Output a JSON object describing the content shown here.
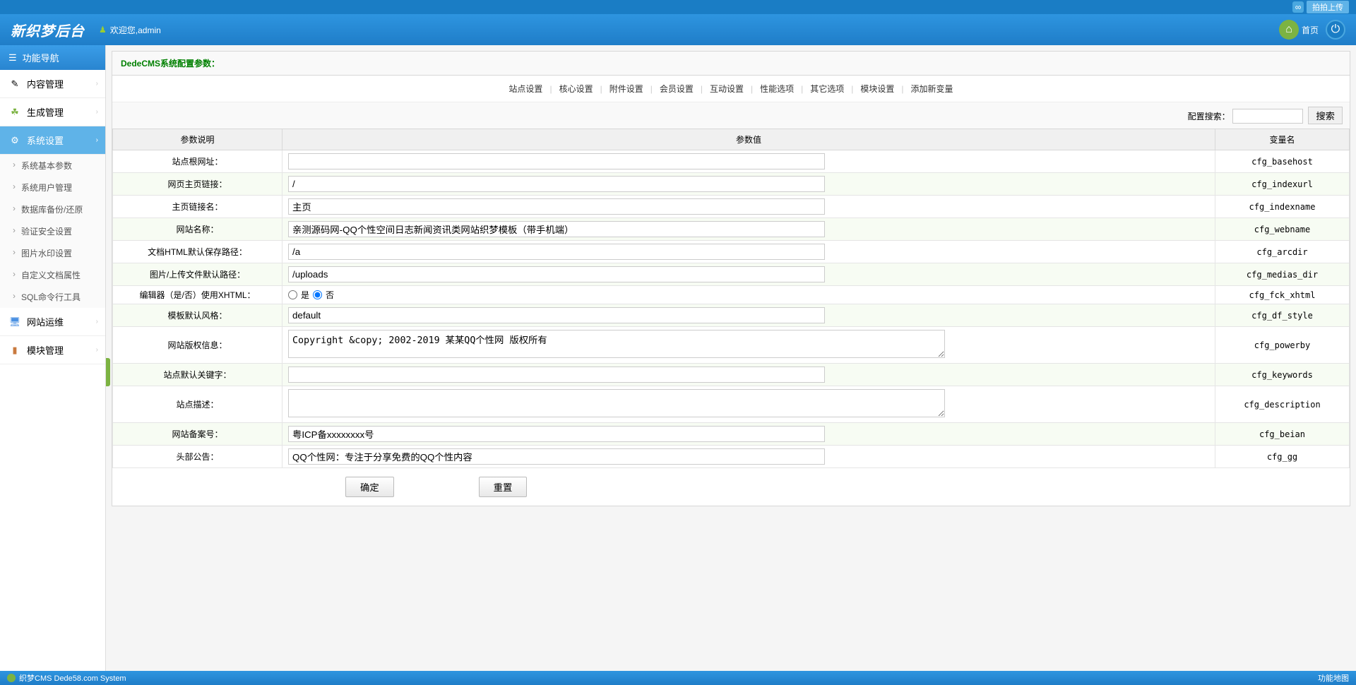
{
  "topStrip": {
    "upload": "拍拍上传"
  },
  "header": {
    "logo": "新织梦后台",
    "welcome": "欢迎您,admin",
    "home": "首页"
  },
  "sidebar": {
    "navHeader": "功能导航",
    "items": [
      {
        "label": "内容管理"
      },
      {
        "label": "生成管理"
      },
      {
        "label": "系统设置"
      },
      {
        "label": "网站运维"
      },
      {
        "label": "模块管理"
      }
    ],
    "subItems": [
      "系统基本参数",
      "系统用户管理",
      "数据库备份/还原",
      "验证安全设置",
      "图片水印设置",
      "自定义文档属性",
      "SQL命令行工具"
    ]
  },
  "main": {
    "title": "DedeCMS系统配置参数：",
    "tabs": [
      "站点设置",
      "核心设置",
      "附件设置",
      "会员设置",
      "互动设置",
      "性能选项",
      "其它选项",
      "模块设置",
      "添加新变量"
    ],
    "searchLabel": "配置搜索：",
    "searchBtn": "搜索",
    "columns": {
      "desc": "参数说明",
      "value": "参数值",
      "var": "变量名"
    },
    "rows": [
      {
        "desc": "站点根网址：",
        "type": "text",
        "value": "",
        "var": "cfg_basehost"
      },
      {
        "desc": "网页主页链接：",
        "type": "text",
        "value": "/",
        "var": "cfg_indexurl"
      },
      {
        "desc": "主页链接名：",
        "type": "text",
        "value": "主页",
        "var": "cfg_indexname"
      },
      {
        "desc": "网站名称：",
        "type": "text",
        "value": "亲测源码网-QQ个性空间日志新闻资讯类网站织梦模板（带手机端）",
        "var": "cfg_webname"
      },
      {
        "desc": "文档HTML默认保存路径：",
        "type": "text",
        "value": "/a",
        "var": "cfg_arcdir"
      },
      {
        "desc": "图片/上传文件默认路径：",
        "type": "text",
        "value": "/uploads",
        "var": "cfg_medias_dir"
      },
      {
        "desc": "编辑器（是/否）使用XHTML：",
        "type": "radio",
        "yes": "是",
        "no": "否",
        "checked": "no",
        "var": "cfg_fck_xhtml"
      },
      {
        "desc": "模板默认风格：",
        "type": "text",
        "value": "default",
        "var": "cfg_df_style"
      },
      {
        "desc": "网站版权信息：",
        "type": "textarea",
        "value": "Copyright &copy; 2002-2019 某某QQ个性网 版权所有",
        "var": "cfg_powerby"
      },
      {
        "desc": "站点默认关键字：",
        "type": "text",
        "value": "",
        "var": "cfg_keywords"
      },
      {
        "desc": "站点描述：",
        "type": "textarea",
        "value": "",
        "var": "cfg_description"
      },
      {
        "desc": "网站备案号：",
        "type": "text",
        "value": "粤ICP备xxxxxxxx号",
        "var": "cfg_beian"
      },
      {
        "desc": "头部公告：",
        "type": "text",
        "value": "QQ个性网：专注于分享免费的QQ个性内容",
        "var": "cfg_gg"
      }
    ],
    "confirm": "确定",
    "reset": "重置"
  },
  "footer": {
    "left": "织梦CMS  Dede58.com System",
    "right": "功能地图"
  }
}
